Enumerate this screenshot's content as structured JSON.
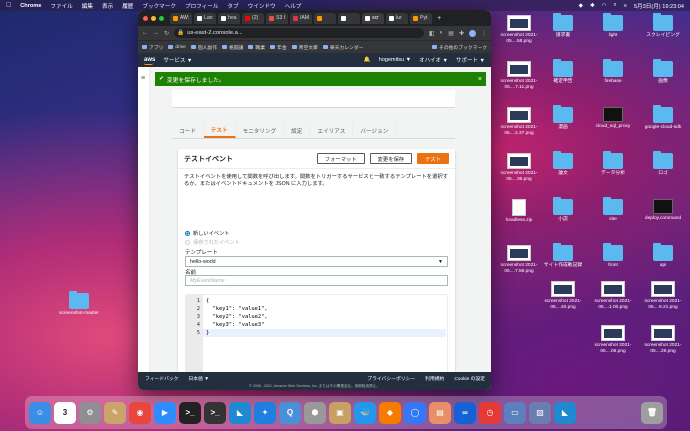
{
  "menubar": {
    "app": "Chrome",
    "items": [
      "ファイル",
      "編集",
      "表示",
      "履歴",
      "ブックマーク",
      "プロフィール",
      "タブ",
      "ウインドウ",
      "ヘルプ"
    ],
    "datetime": "5月3日(月) 19:23:04"
  },
  "browser": {
    "tabs": [
      {
        "label": "AW:",
        "color": "#ff9900"
      },
      {
        "label": "Lan",
        "color": "#ffffff"
      },
      {
        "label": "hea",
        "color": "#ffffff"
      },
      {
        "label": "(2)",
        "color": "#ff0000"
      },
      {
        "label": "S3 I",
        "color": "#e05243"
      },
      {
        "label": "IAM",
        "color": "#dd344c"
      },
      {
        "label": "",
        "color": "#ff9900"
      },
      {
        "label": "",
        "color": "#ffffff"
      },
      {
        "label": "scr",
        "color": "#ffffff"
      },
      {
        "label": "lur",
        "color": "#ffffff"
      },
      {
        "label": "Pyt",
        "color": "#ff9900"
      }
    ],
    "url": "us-east-2.console.a...",
    "bookmarks": [
      "アプリ",
      "drive",
      "個人副作",
      "格闘議",
      "職業",
      "年金",
      "青空文庫",
      "楽天カレンダー",
      "その他のブックマーク"
    ]
  },
  "aws": {
    "logo": "aws",
    "services": "サービス ▼",
    "user": "hogemitsu ▼",
    "region": "オハイオ ▼",
    "support": "サポート ▼"
  },
  "flash": {
    "message": "変更を保存しました。"
  },
  "tabs": [
    "コード",
    "テスト",
    "モニタリング",
    "設定",
    "エイリアス",
    "バージョン"
  ],
  "panel": {
    "title": "テストイベント",
    "format_button": "フォーマット",
    "save_button": "変更を保存",
    "test_button": "テスト",
    "description": "テストイベントを使用して関数を呼び出します。関数をトリガーするサービスと一致するテンプレートを選択するか、またはイベントドキュメントを JSON に入力します。",
    "radio_new": "新しいイベント",
    "radio_saved": "保存されたイベント",
    "template_label": "テンプレート",
    "template_value": "hello-world",
    "name_label": "名前",
    "name_placeholder": "MyEventName"
  },
  "editor": {
    "line_numbers": [
      "1",
      "2",
      "3",
      "4",
      "5"
    ],
    "lines": [
      "{",
      "  \"key1\": \"value1\",",
      "  \"key2\": \"value2\",",
      "  \"key3\": \"value3\"",
      "}"
    ]
  },
  "footer": {
    "feedback": "フィードバック",
    "language": "日本語 ▼",
    "privacy": "プライバシーポリシー",
    "terms": "利用規約",
    "cookie": "Cookie の設定",
    "copyright": "© 2008 - 2021, Amazon Web Services, Inc. またはその関連会社。無断転用禁止。"
  },
  "desktop": {
    "left_folder": "screenshot-master",
    "icons": [
      {
        "label": "screenshot 2021-05....58.png",
        "kind": "shot"
      },
      {
        "label": "請求書",
        "kind": "folder"
      },
      {
        "label": "light",
        "kind": "folder"
      },
      {
        "label": "スクレイピング",
        "kind": "folder"
      },
      {
        "label": "screenshot 2021-05....7.11.png",
        "kind": "shot"
      },
      {
        "label": "確定申告",
        "kind": "folder"
      },
      {
        "label": "firebase",
        "kind": "folder"
      },
      {
        "label": "画像",
        "kind": "folder"
      },
      {
        "label": "screenshot 2021-05....2.37.png",
        "kind": "shot"
      },
      {
        "label": "漫画",
        "kind": "folder"
      },
      {
        "label": "cloud_sql_proxy",
        "kind": "term"
      },
      {
        "label": "google-cloud-sdk",
        "kind": "folder"
      },
      {
        "label": "screenshot 2021-05....36.png",
        "kind": "shot"
      },
      {
        "label": "論文",
        "kind": "folder"
      },
      {
        "label": "データ分析",
        "kind": "folder"
      },
      {
        "label": "ロゴ",
        "kind": "folder"
      },
      {
        "label": "headless.zip",
        "kind": "doc"
      },
      {
        "label": "小説",
        "kind": "folder"
      },
      {
        "label": "site",
        "kind": "folder"
      },
      {
        "label": "deploy.command",
        "kind": "term"
      },
      {
        "label": "screenshot 2021-05....7.56.png",
        "kind": "shot"
      },
      {
        "label": "サイト作成軌記録",
        "kind": "folder"
      },
      {
        "label": "front",
        "kind": "folder"
      },
      {
        "label": "api",
        "kind": "folder"
      },
      {
        "label": "screenshot 2021-05....40.png",
        "kind": "shot"
      },
      {
        "label": "screenshot 2021-05....1.00.png",
        "kind": "shot"
      },
      {
        "label": "screenshot 2021-05....9.21.png",
        "kind": "shot"
      },
      {
        "label": "screenshot 2021-05....06.png",
        "kind": "shot"
      },
      {
        "label": "screenshot 2021-05....29.png",
        "kind": "shot"
      }
    ]
  },
  "dock": {
    "calendar_day": "3",
    "apps": [
      {
        "name": "finder",
        "color": "#3a8ee6",
        "glyph": "☺"
      },
      {
        "name": "calendar",
        "color": "#ffffff",
        "glyph": ""
      },
      {
        "name": "system-preferences",
        "color": "#8e8e93",
        "glyph": "⚙"
      },
      {
        "name": "notes",
        "color": "#caa46a",
        "glyph": "✎"
      },
      {
        "name": "chrome",
        "color": "#e8453c",
        "glyph": "◉"
      },
      {
        "name": "zoom",
        "color": "#2d8cff",
        "glyph": "▶"
      },
      {
        "name": "terminal",
        "color": "#222222",
        "glyph": ">_"
      },
      {
        "name": "terminal-2",
        "color": "#333333",
        "glyph": ">_"
      },
      {
        "name": "vscode",
        "color": "#1f8ad2",
        "glyph": "◣"
      },
      {
        "name": "safari",
        "color": "#1e7fe0",
        "glyph": "✦"
      },
      {
        "name": "quicktime",
        "color": "#4a90d9",
        "glyph": "Q"
      },
      {
        "name": "docker-desktop",
        "color": "#999999",
        "glyph": "⬢"
      },
      {
        "name": "archive",
        "color": "#c8a064",
        "glyph": "▣"
      },
      {
        "name": "docker",
        "color": "#2496ed",
        "glyph": "🐳"
      },
      {
        "name": "sourcetree",
        "color": "#f57c00",
        "glyph": "◆"
      },
      {
        "name": "app-store",
        "color": "#3478f6",
        "glyph": "◯"
      },
      {
        "name": "preview",
        "color": "#e88f6a",
        "glyph": "▤"
      },
      {
        "name": "infinity",
        "color": "#1561d5",
        "glyph": "∞"
      },
      {
        "name": "clock",
        "color": "#e53935",
        "glyph": "◷"
      },
      {
        "name": "finder-window",
        "color": "#5b7fbf",
        "glyph": "▭"
      },
      {
        "name": "screenshot",
        "color": "#6a7fb0",
        "glyph": "▨"
      },
      {
        "name": "vscode-2",
        "color": "#1f8ad2",
        "glyph": "◣"
      },
      {
        "name": "trash",
        "color": "#9e9e9e",
        "glyph": "🗑"
      }
    ]
  }
}
